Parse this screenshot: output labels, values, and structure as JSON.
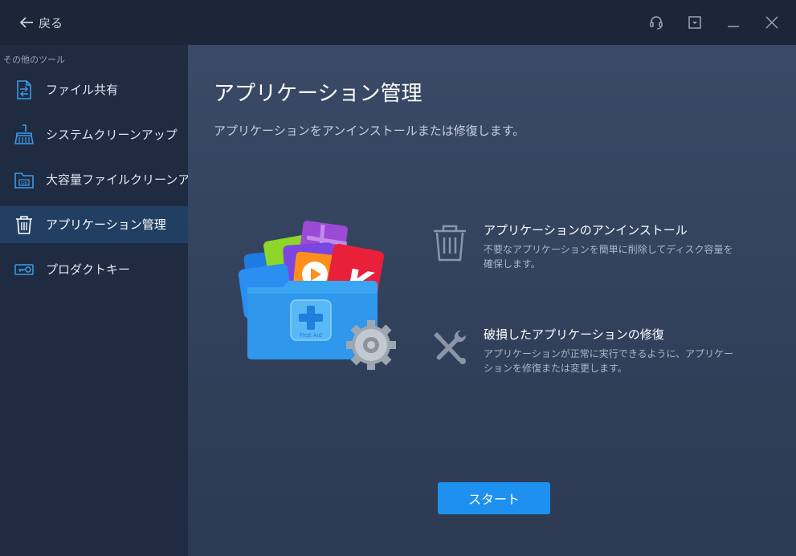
{
  "window": {
    "back_label": "戻る",
    "controls": [
      "headset-icon",
      "dropdown-icon",
      "minimize-icon",
      "close-icon"
    ]
  },
  "sidebar": {
    "heading": "その他のツール",
    "items": [
      {
        "label": "ファイル共有",
        "icon": "file-share-icon",
        "active": false
      },
      {
        "label": "システムクリーンアップ",
        "icon": "broom-icon",
        "active": false
      },
      {
        "label": "大容量ファイルクリーンアップ",
        "icon": "gb-folder-icon",
        "active": false
      },
      {
        "label": "アプリケーション管理",
        "icon": "trash-icon",
        "active": true
      },
      {
        "label": "プロダクトキー",
        "icon": "key-icon",
        "active": false
      }
    ]
  },
  "main": {
    "title": "アプリケーション管理",
    "subtitle": "アプリケーションをアンインストールまたは修復します。",
    "hero": {
      "folder_text": "First Aid",
      "icon": "app-folder-icon"
    },
    "features": [
      {
        "title": "アプリケーションのアンインストール",
        "description": "不要なアプリケーションを簡単に削除してディスク容量を確保します。",
        "icon": "trash-icon"
      },
      {
        "title": "破損したアプリケーションの修復",
        "description": "アプリケーションが正常に実行できるように、アプリケーションを修復または変更します。",
        "icon": "repair-tools-icon"
      }
    ],
    "start_label": "スタート"
  },
  "colors": {
    "accent": "#1e90f0",
    "sidebar_bg": "#1e2b40",
    "active_item_bg": "#213f63",
    "titlebar_bg": "#1b2638",
    "main_bg": "#36455f"
  }
}
